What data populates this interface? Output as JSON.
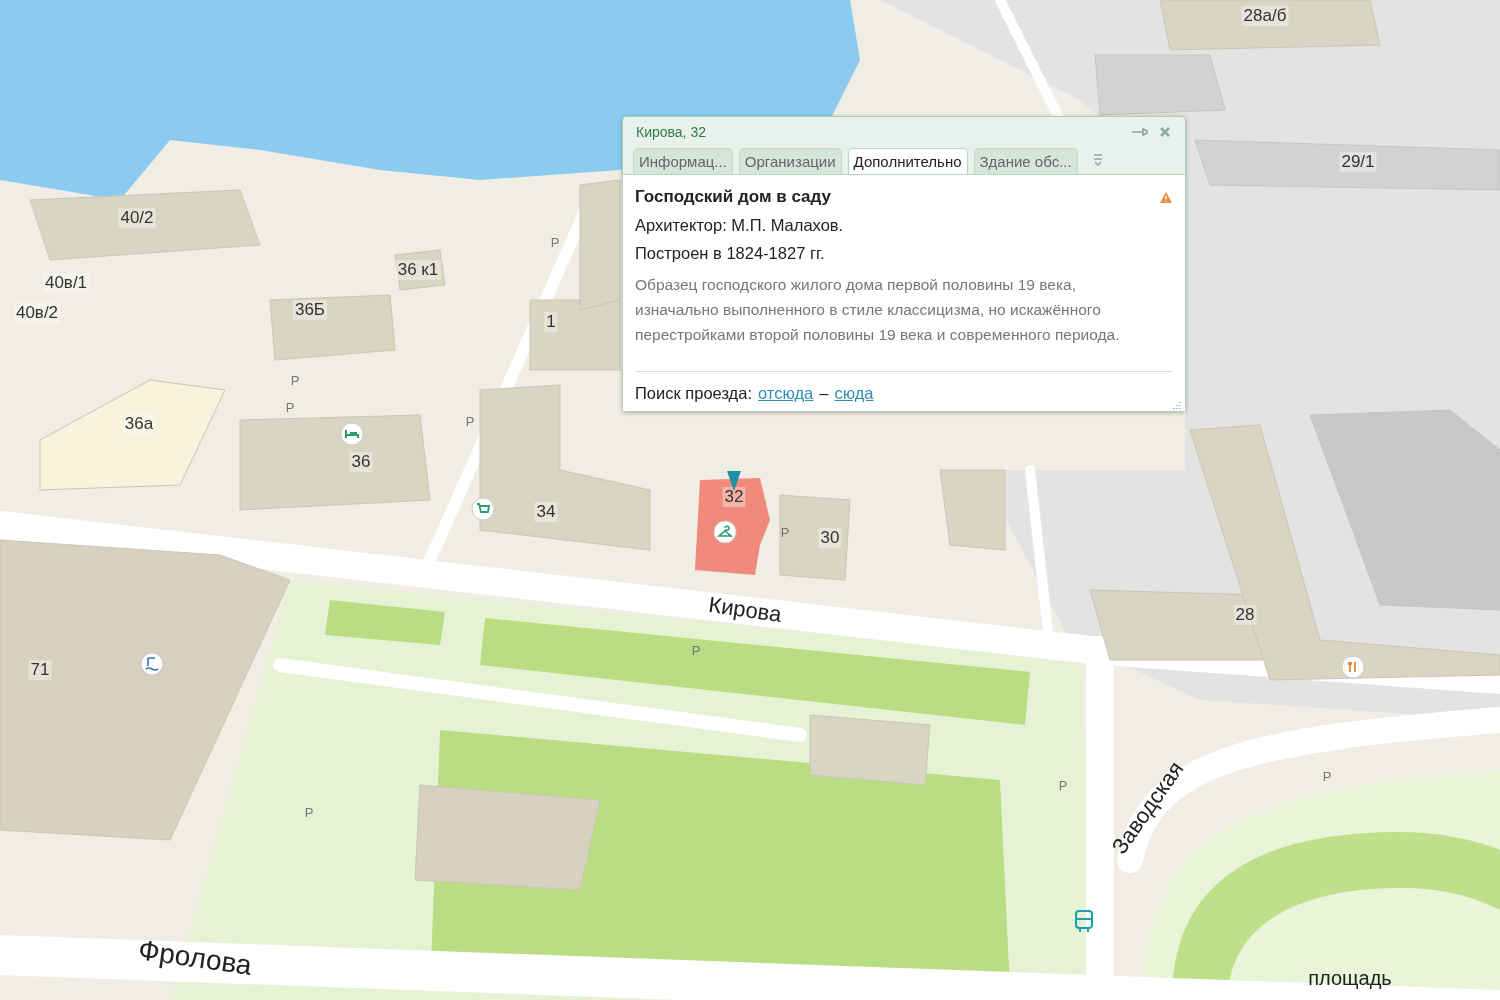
{
  "map": {
    "building_labels": [
      "28а/б",
      "29/1",
      "40/2",
      "40в/1",
      "40в/2",
      "36 к1",
      "36Б",
      "1",
      "36а",
      "36",
      "34",
      "30",
      "28",
      "71"
    ],
    "parking_labels": [
      "P",
      "P",
      "P",
      "P",
      "P",
      "P",
      "P",
      "P",
      "P"
    ],
    "street_labels": [
      "Кирова",
      "Заводская",
      "Фролова",
      "площадь"
    ],
    "selected_building": {
      "label": "32"
    }
  },
  "popup": {
    "title": "Кирова, 32",
    "tabs": [
      {
        "label": "Информац...",
        "selected": false
      },
      {
        "label": "Организации",
        "selected": false
      },
      {
        "label": "Дополнительно",
        "selected": true
      },
      {
        "label": "Здание обс...",
        "selected": false
      }
    ],
    "heading": "Господский дом в саду",
    "lines": [
      "Архитектор: М.П. Малахов.",
      "Построен в 1824-1827 гг."
    ],
    "description": "Образец господского жилого дома первой половины 19 века, изначально выполненного в стиле классицизма, но искажённого перестройками второй половины 19 века и современного периода.",
    "route": {
      "label": "Поиск проезда:",
      "from": "отсюда",
      "separator": "–",
      "to": "сюда"
    }
  }
}
